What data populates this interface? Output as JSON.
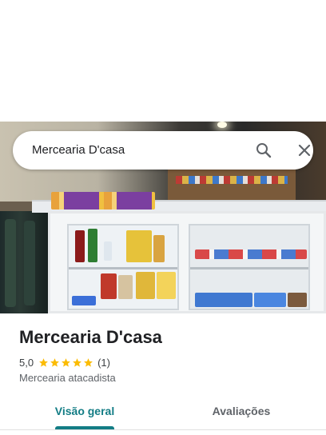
{
  "search": {
    "query": "Mercearia D'casa"
  },
  "place": {
    "name": "Mercearia D'casa",
    "rating": "5,0",
    "stars": 5,
    "review_count": "(1)",
    "category": "Mercearia atacadista"
  },
  "tabs": [
    {
      "label": "Visão geral",
      "active": true
    },
    {
      "label": "Avaliações",
      "active": false
    }
  ],
  "icons": {
    "search": "search-icon",
    "close": "close-icon",
    "star": "star-icon"
  },
  "colors": {
    "accent": "#137d85",
    "star": "#fbbc04",
    "text_primary": "#202124",
    "text_secondary": "#5f6368"
  }
}
